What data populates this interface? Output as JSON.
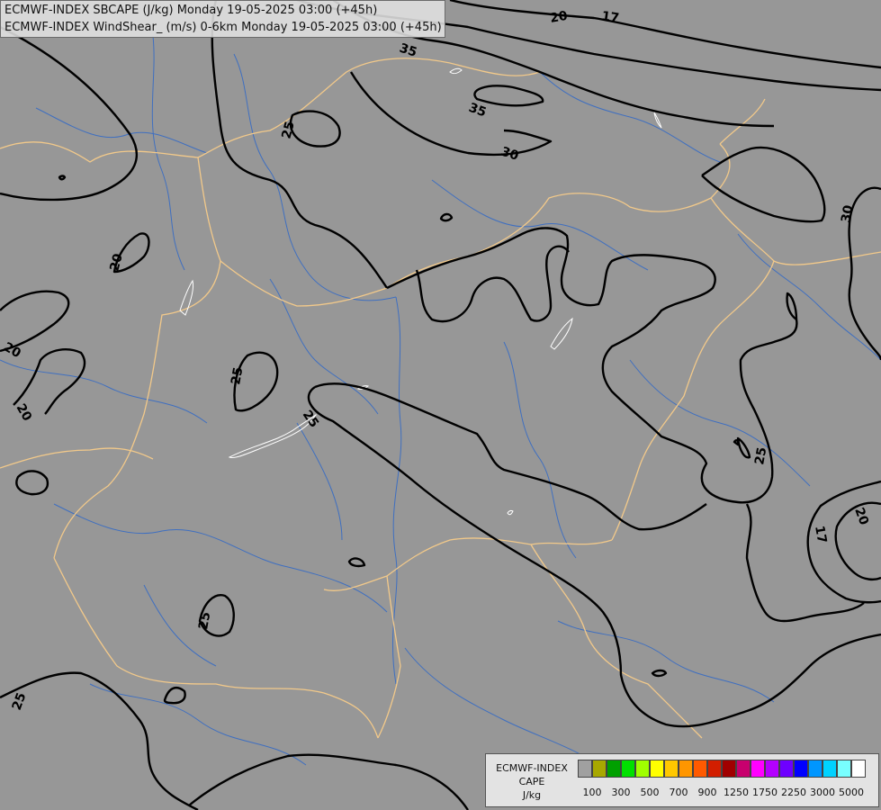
{
  "header": {
    "line1": "ECMWF-INDEX SBCAPE (J/kg) Monday 19-05-2025 03:00 (+45h)",
    "line2": "ECMWF-INDEX WindShear_ (m/s) 0-6km Monday 19-05-2025 03:00 (+45h)"
  },
  "contour_labels": [
    "17",
    "20",
    "35",
    "35",
    "30",
    "25",
    "20",
    "20",
    "20",
    "25",
    "25",
    "25",
    "25",
    "30",
    "17",
    "20",
    "25"
  ],
  "legend": {
    "title_line1": "ECMWF-INDEX",
    "title_line2": "CAPE",
    "title_line3": "J/kg",
    "colors": [
      "#a0a0a0",
      "#a8a800",
      "#00a000",
      "#00e000",
      "#a0ff00",
      "#ffff00",
      "#ffc800",
      "#ff9600",
      "#ff5a00",
      "#d21e00",
      "#a00000",
      "#c8006e",
      "#ff00ff",
      "#b400ff",
      "#6e00ff",
      "#0000ff",
      "#0096ff",
      "#00d2ff",
      "#78ffff",
      "#ffffff"
    ],
    "tick_labels": [
      "100",
      "300",
      "500",
      "700",
      "900",
      "1250",
      "1750",
      "2250",
      "3000",
      "5000"
    ]
  },
  "colors": {
    "background": "#979797",
    "contour": "#000000",
    "border": "#f2c98a",
    "river": "#3f6fc0",
    "lake": "#ffffff"
  }
}
